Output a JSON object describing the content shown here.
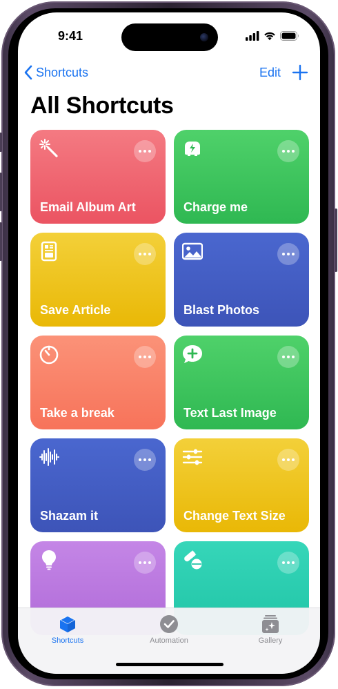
{
  "status_bar": {
    "time": "9:41"
  },
  "nav": {
    "back_label": "Shortcuts",
    "edit_label": "Edit",
    "accent": "#1a73f0"
  },
  "page": {
    "title": "All Shortcuts"
  },
  "shortcuts": [
    {
      "label": "Email Album Art",
      "icon": "magic-wand-icon",
      "color_top": "#f47a82",
      "color_bottom": "#eb5462"
    },
    {
      "label": "Charge me",
      "icon": "car-bolt-icon",
      "color_top": "#4fd16a",
      "color_bottom": "#2fb852"
    },
    {
      "label": "Save Article",
      "icon": "article-icon",
      "color_top": "#f3d039",
      "color_bottom": "#e9b806"
    },
    {
      "label": "Blast Photos",
      "icon": "photo-icon",
      "color_top": "#4a67cf",
      "color_bottom": "#3d54b8"
    },
    {
      "label": "Take a break",
      "icon": "timer-icon",
      "color_top": "#fb9278",
      "color_bottom": "#f7735a"
    },
    {
      "label": "Text Last Image",
      "icon": "message-plus-icon",
      "color_top": "#4fd16a",
      "color_bottom": "#2fb852"
    },
    {
      "label": "Shazam it",
      "icon": "waveform-icon",
      "color_top": "#4a67cf",
      "color_bottom": "#3d54b8"
    },
    {
      "label": "Change Text Size",
      "icon": "sliders-icon",
      "color_top": "#f3d039",
      "color_bottom": "#e9b806"
    },
    {
      "label": "",
      "icon": "lightbulb-icon",
      "color_top": "#c486e6",
      "color_bottom": "#b06ad8"
    },
    {
      "label": "",
      "icon": "pills-icon",
      "color_top": "#36d6b9",
      "color_bottom": "#20c4a6"
    }
  ],
  "tabbar": {
    "tabs": [
      {
        "label": "Shortcuts",
        "icon": "layers-icon",
        "active": true
      },
      {
        "label": "Automation",
        "icon": "clock-check-icon",
        "active": false
      },
      {
        "label": "Gallery",
        "icon": "sparkle-stack-icon",
        "active": false
      }
    ],
    "active_color": "#1a73f0",
    "inactive_color": "#8e8e93"
  }
}
